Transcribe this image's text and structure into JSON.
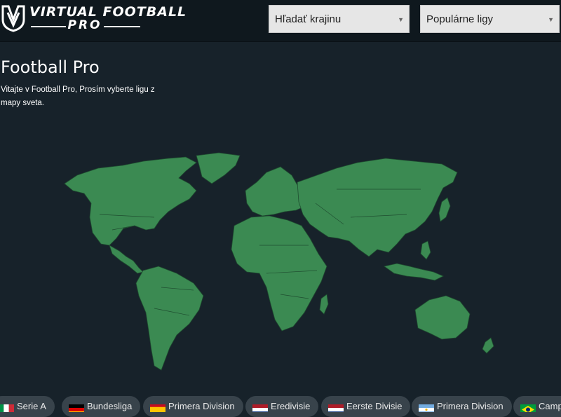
{
  "header": {
    "logo_line1": "VIRTUAL FOOTBALL",
    "logo_line2": "PRO",
    "country_select": "Hľadať krajinu",
    "league_select": "Populárne ligy"
  },
  "main": {
    "title": "Football Pro",
    "subtitle": "Vitajte v Football Pro, Prosím vyberte ligu z mapy sveta."
  },
  "leagues": [
    {
      "label": "Serie A",
      "flag": "italy-flag"
    },
    {
      "label": "Bundesliga",
      "flag": "germany-flag"
    },
    {
      "label": "Primera Division",
      "flag": "spain-flag"
    },
    {
      "label": "Eredivisie",
      "flag": "netherlands-flag"
    },
    {
      "label": "Eerste Divisie",
      "flag": "netherlands-flag"
    },
    {
      "label": "Primera Division",
      "flag": "argentina-flag"
    },
    {
      "label": "Camp",
      "flag": "brazil-flag"
    }
  ],
  "colors": {
    "background": "#17222a",
    "header": "#0f181e",
    "land": "#3b8a52",
    "chip": "#38434b"
  }
}
